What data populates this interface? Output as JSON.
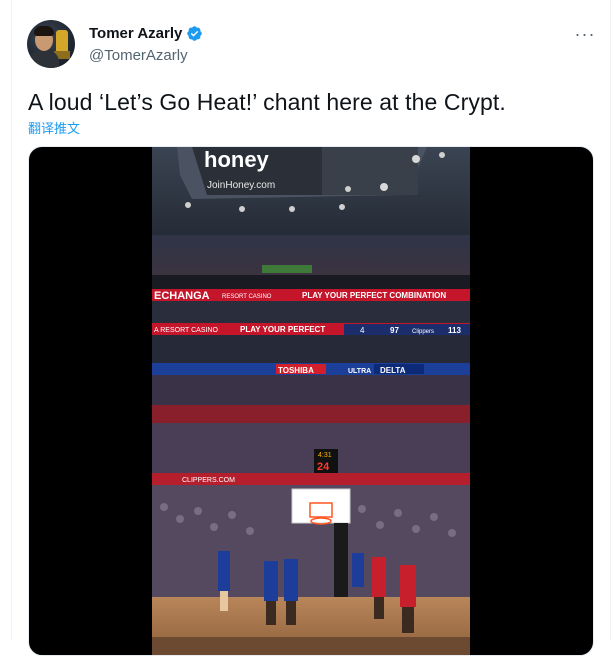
{
  "user": {
    "display_name": "Tomer Azarly",
    "handle": "@TomerAzarly",
    "verified": true,
    "avatar_icon": "profile-photo"
  },
  "tweet": {
    "text": "A loud ‘Let’s Go Heat!’ chant here at the Crypt.",
    "translate_link": "翻译推文"
  },
  "menu": {
    "more_icon": "more-horizontal-icon"
  },
  "media": {
    "type": "video",
    "in_frame_text": {
      "top_sign": "honey",
      "top_sign_url": "JoinHoney.com",
      "ribbon_1_left": "ECHANGA",
      "ribbon_1_mid": "RESORT CASINO",
      "ribbon_1_right": "PLAY YOUR PERFECT COMBINATION",
      "ribbon_2_left": "A RESORT CASINO",
      "ribbon_2_mid": "PLAY YOUR PERFECT",
      "score_left": "4",
      "score_mid": "97",
      "score_team": "Clippers",
      "score_right": "113",
      "ad_toshiba": "TOSHIBA",
      "ad_ultra": "ULTRA",
      "ad_delta": "DELTA",
      "shot_clock": "24",
      "shot_clock_top": "4:31",
      "baseline": "CLIPPERS.COM"
    }
  },
  "colors": {
    "accent": "#1d9bf0",
    "text_primary": "#0f1419",
    "text_secondary": "#536471"
  }
}
